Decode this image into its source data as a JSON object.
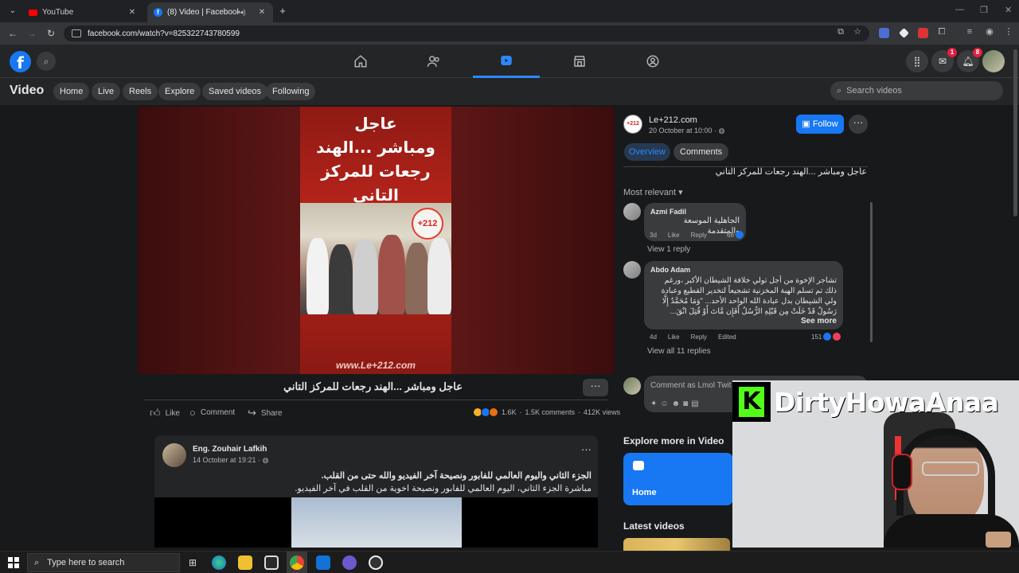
{
  "browser": {
    "tabs": [
      {
        "title": "YouTube"
      },
      {
        "title": "(8) Video | Facebook"
      }
    ],
    "url": "facebook.com/watch?v=825322743780599"
  },
  "header": {
    "messenger_badge": "1",
    "notifications_badge": "8"
  },
  "subnav": {
    "title": "Video",
    "pills": [
      "Home",
      "Live",
      "Reels",
      "Explore",
      "Saved videos",
      "Following"
    ],
    "search_placeholder": "Search videos"
  },
  "video": {
    "overlay_lines": [
      "عاجل",
      "ومباشر ...الهند",
      "رجعات للمركز",
      "التاني"
    ],
    "logo_text": "+212",
    "watermark": "www.Le+212.com",
    "title": "عاجل ومباشر ...الهند رجعات للمركز التاني",
    "actions": {
      "like": "Like",
      "comment": "Comment",
      "share": "Share"
    },
    "stats": {
      "reactions": "1.6K",
      "comments": "1.5K comments",
      "views": "412K views"
    }
  },
  "next_post": {
    "author": "Eng. Zouhair Lafkih",
    "date": "14 October at 19:21 · ",
    "line1": "الجزء الثاني واليوم العالمي للفابور ونصيحة آخر الفيديو والله حتى من القلب.",
    "line2": "مباشرة الجزء الثاني، اليوم العالمي للفابور ونصيحة اخوية من القلب في آخر الفيديو."
  },
  "side_panel": {
    "page_name": "Le+212.com",
    "page_avatar_text": "+212",
    "page_date": "20 October at 10:00 · ",
    "follow_label": "Follow",
    "tabs": [
      "Overview",
      "Comments"
    ],
    "caption": "عاجل ومباشر ...الهند رجعات للمركز التاني",
    "sort_label": "Most relevant",
    "comments": [
      {
        "name": "Azmi Fadil",
        "text": "الجاهلية الموسعة والمتقدمة",
        "age": "3d",
        "like": "Like",
        "reply": "Reply",
        "edited": "",
        "count": "68",
        "replies": "View 1 reply"
      },
      {
        "name": "Abdo Adam",
        "text": "تشاجر الإخوة من أجل تولي خلافة الشيطان الأكبر ،ورغم ذلك تم تسلم الهبة المخزنية تشجيعاً لتخدير القطيع وعبادة ولي الشيطان بدل عبادة الله الواحد الأحد... \"وَمَا مُحَمَّدٌ إِلَّا رَسُولٌ قَدْ خَلَتْ مِن قَبْلِهِ الرُّسُلُ أَفَإِن مَّاتَ أَوْ قُتِلَ انْقَ...",
        "see_more": "See more",
        "age": "4d",
        "like": "Like",
        "reply": "Reply",
        "edited": "Edited",
        "count": "151",
        "replies": "View all 11 replies"
      }
    ],
    "comment_placeholder": "Comment as Lmol Twit Ammi Ayman",
    "explore_title": "Explore more in Video",
    "explore_home": "Home",
    "latest_title": "Latest videos"
  },
  "stream": {
    "k_letter": "K",
    "name": "DirtyHowaAnaa"
  },
  "taskbar": {
    "search_placeholder": "Type here to search"
  },
  "colors": {
    "accent": "#1877f2",
    "kick_green": "#53fc18",
    "badge": "#e41e3f"
  }
}
